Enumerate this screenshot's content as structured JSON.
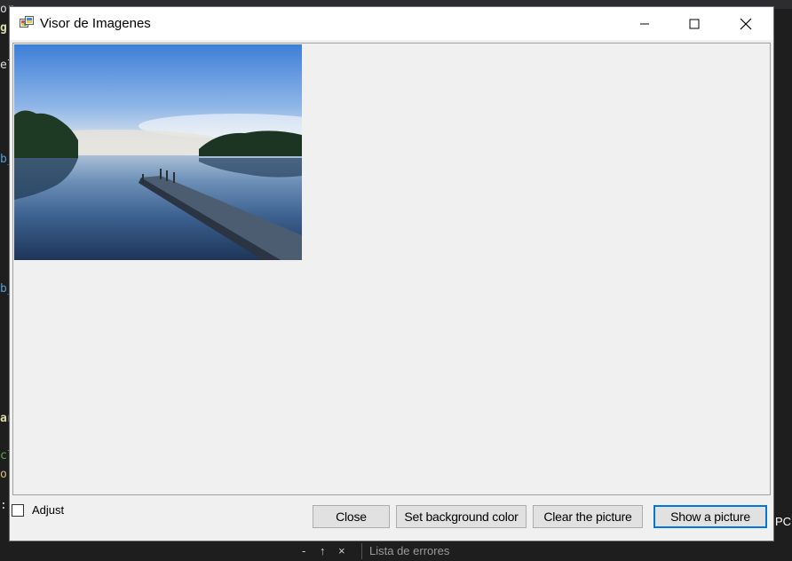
{
  "background": {
    "left_fragments": [
      "or",
      "g",
      "el",
      "b_",
      "b_",
      "ar",
      "cl",
      "o",
      ":"
    ],
    "right_fragment": "PC",
    "bottom_tab": "Lista de errores",
    "bottom_controls": [
      "-",
      "↑",
      "×"
    ]
  },
  "window": {
    "title": "Visor de Imagenes",
    "icons": {
      "app": "app-icon",
      "minimize": "minimize-icon",
      "maximize": "maximize-icon",
      "close": "close-icon"
    }
  },
  "picture": {
    "description_icon": "lake-pier-photo"
  },
  "controls": {
    "adjust_label": "Adjust",
    "adjust_checked": false,
    "buttons": {
      "close": "Close",
      "set_background": "Set background color",
      "clear": "Clear the picture",
      "show": "Show a picture"
    }
  },
  "colors": {
    "accent": "#0078d7",
    "window_bg": "#f0f0f0",
    "titlebar_bg": "#ffffff",
    "ide_bg": "#1e1e1e"
  }
}
